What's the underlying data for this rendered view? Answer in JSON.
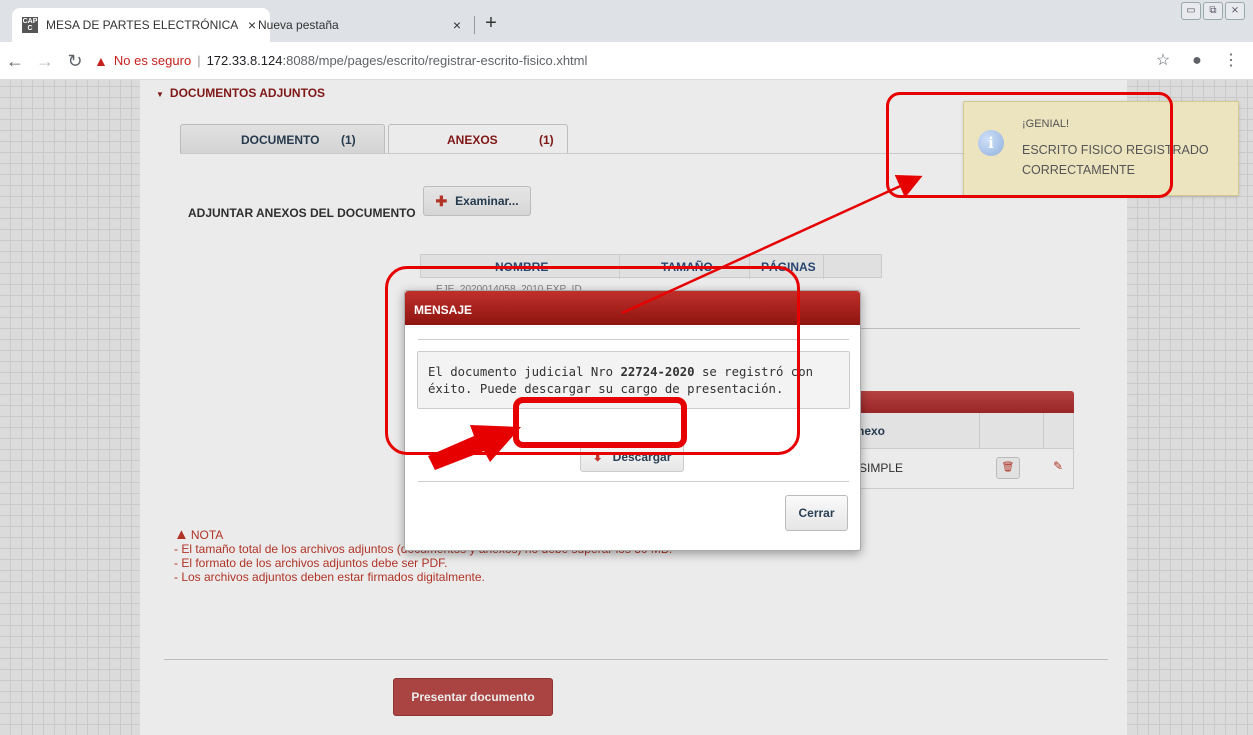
{
  "browser": {
    "tabs": [
      {
        "title": "MESA DE PARTES ELECTRÓNICA",
        "favicon": "CAP\nC",
        "active": true
      },
      {
        "title": "Nueva pestaña",
        "active": false
      }
    ],
    "new_tab_icon": "+",
    "close_icon": "×",
    "address": {
      "insecure_label": "No es seguro",
      "host": "172.33.8.124",
      "path": ":8088/mpe/pages/escrito/registrar-escrito-fisico.xhtml"
    }
  },
  "page": {
    "section_title": "DOCUMENTOS ADJUNTOS",
    "tabs": [
      {
        "label": "DOCUMENTO",
        "count": "(1)"
      },
      {
        "label": "ANEXOS",
        "count": "(1)"
      }
    ],
    "attach_label": "ADJUNTAR ANEXOS DEL DOCUMENTO",
    "examine_button": "Examinar...",
    "files_table": {
      "columns": [
        "NOMBRE",
        "TAMAÑO",
        "PÁGINAS"
      ],
      "ghost_row": "EJE_2020014058_2010 EXP_ID"
    },
    "list_table": {
      "header": "nexo",
      "row_type": "SIMPLE"
    },
    "nota": {
      "title": "NOTA",
      "lines": [
        "- El tamaño total de los archivos adjuntos (documentos y anexos) no debe superar los 30 MB.",
        "- El formato de los archivos adjuntos debe ser PDF.",
        "- Los archivos adjuntos deben estar firmados digitalmente."
      ]
    },
    "submit_button": "Presentar documento"
  },
  "growl": {
    "title": "¡GENIAL!",
    "message": "ESCRITO FISICO REGISTRADO CORRECTAMENTE",
    "icon": "info-icon"
  },
  "dialog": {
    "title": "MENSAJE",
    "message_pre": "El documento judicial Nro ",
    "doc_number": "22724-2020",
    "message_post": " se registró con éxito. Puede descargar su cargo de presentación.",
    "download_button": "Descargar",
    "close_button": "Cerrar"
  },
  "colors": {
    "accent": "#b94a48",
    "header_red": "#a52a2a",
    "annotation": "#e60000",
    "growl_bg": "#ece3bf"
  }
}
